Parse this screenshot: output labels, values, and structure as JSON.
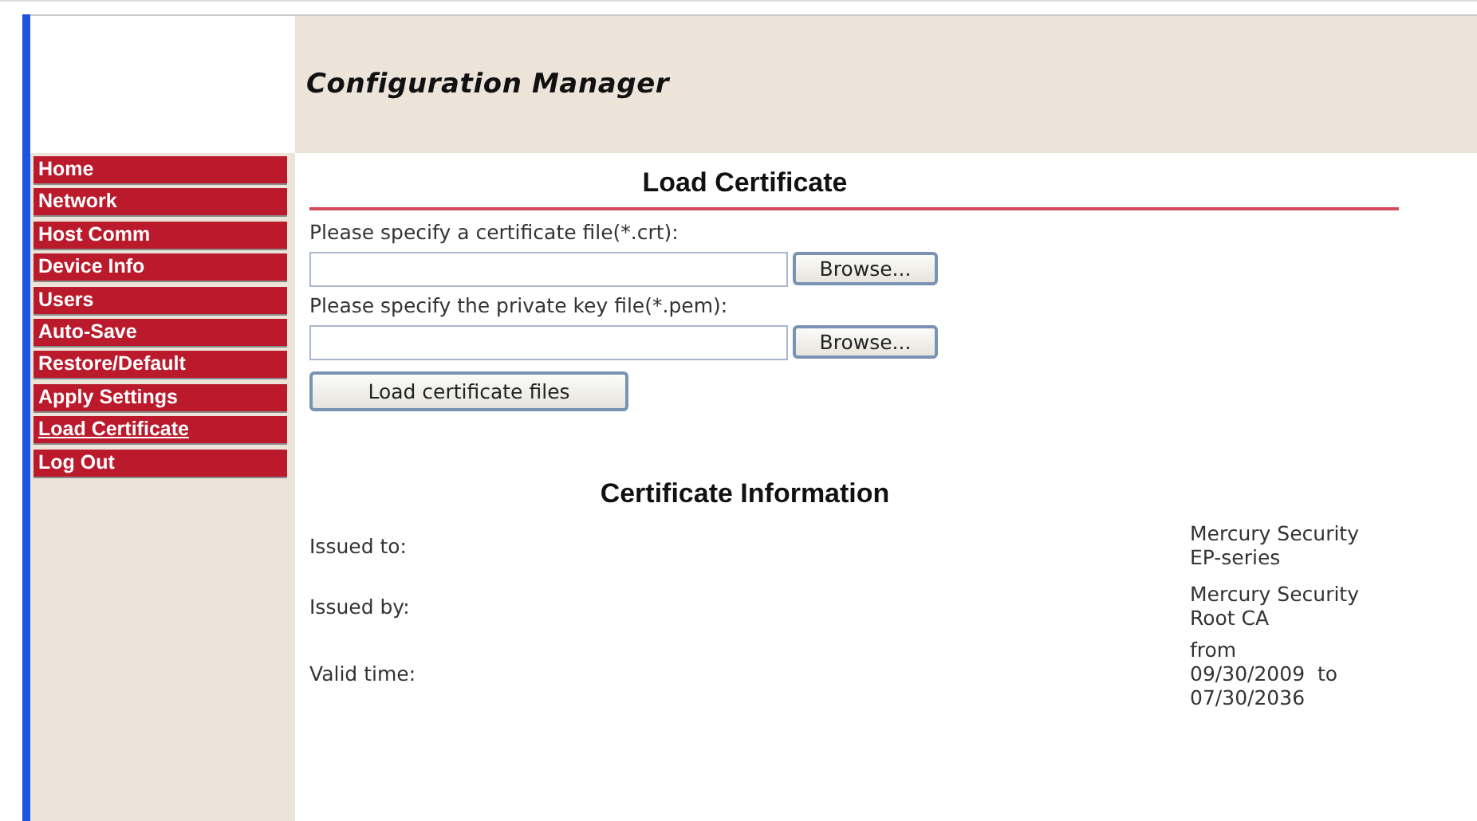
{
  "header": {
    "title": "Configuration Manager"
  },
  "nav": [
    {
      "label": "Home",
      "selected": false
    },
    {
      "label": "Network",
      "selected": false
    },
    {
      "label": "Host Comm",
      "selected": false
    },
    {
      "label": "Device Info",
      "selected": false
    },
    {
      "label": "Users",
      "selected": false
    },
    {
      "label": "Auto-Save",
      "selected": false
    },
    {
      "label": "Restore/Default",
      "selected": false
    },
    {
      "label": "Apply Settings",
      "selected": false
    },
    {
      "label": "Load Certificate",
      "selected": true
    },
    {
      "label": "Log Out",
      "selected": false
    }
  ],
  "load_section": {
    "title": "Load Certificate",
    "files": [
      {
        "label": "Please specify a certificate file(*.crt):",
        "button": "Browse..."
      },
      {
        "label": "Please specify the private key file(*.pem):",
        "button": "Browse..."
      }
    ],
    "submit": "Load certificate files"
  },
  "info_section": {
    "title": "Certificate Information",
    "rows": [
      {
        "label": "Issued to:",
        "value": [
          "Mercury Security",
          "EP-series"
        ]
      },
      {
        "label": "Issued by:",
        "value": [
          "Mercury Security",
          "Root CA"
        ]
      },
      {
        "label": "Valid time:",
        "value": [
          "from",
          "09/30/2009  to",
          "07/30/2036"
        ]
      }
    ]
  }
}
